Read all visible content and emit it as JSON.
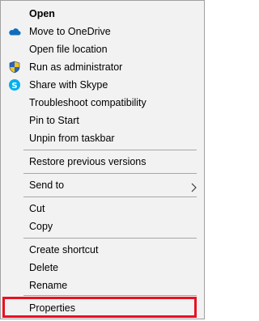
{
  "menu": {
    "items": [
      {
        "label": "Open"
      },
      {
        "label": "Move to OneDrive",
        "icon": "onedrive-cloud-icon"
      },
      {
        "label": "Open file location"
      },
      {
        "label": "Run as administrator",
        "icon": "uac-shield-icon"
      },
      {
        "label": "Share with Skype",
        "icon": "skype-icon"
      },
      {
        "label": "Troubleshoot compatibility"
      },
      {
        "label": "Pin to Start"
      },
      {
        "label": "Unpin from taskbar"
      },
      {
        "label": "Restore previous versions"
      },
      {
        "label": "Send to",
        "icon": "chevron-right-icon"
      },
      {
        "label": "Cut"
      },
      {
        "label": "Copy"
      },
      {
        "label": "Create shortcut"
      },
      {
        "label": "Delete"
      },
      {
        "label": "Rename"
      },
      {
        "label": "Properties"
      }
    ]
  },
  "colors": {
    "menu_background": "#f2f2f2",
    "highlight_border": "#e81123",
    "onedrive_blue": "#0f6cbd",
    "skype_blue": "#00aff0"
  }
}
